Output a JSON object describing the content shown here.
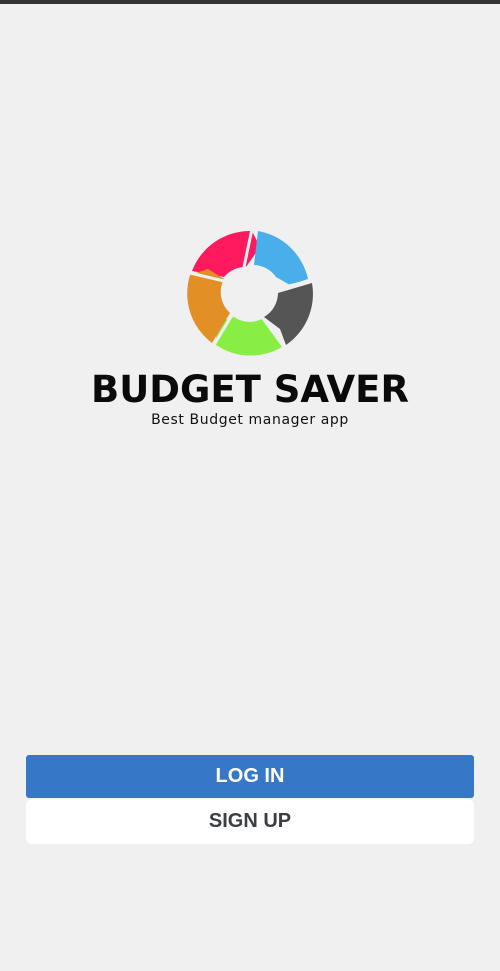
{
  "brand": {
    "title": "BUDGET SAVER",
    "tagline": "Best Budget manager app",
    "logo_icon": "cycle-arrows-logo-icon",
    "logo_colors": [
      "#ff1a5e",
      "#4aaeea",
      "#555555",
      "#88ee44",
      "#e28f26"
    ]
  },
  "actions": {
    "login_label": "LOG IN",
    "signup_label": "SIGN UP"
  },
  "colors": {
    "background": "#f0f0f0",
    "primary": "#3678c7",
    "secondary_bg": "#ffffff",
    "secondary_text": "#3a3f47"
  }
}
